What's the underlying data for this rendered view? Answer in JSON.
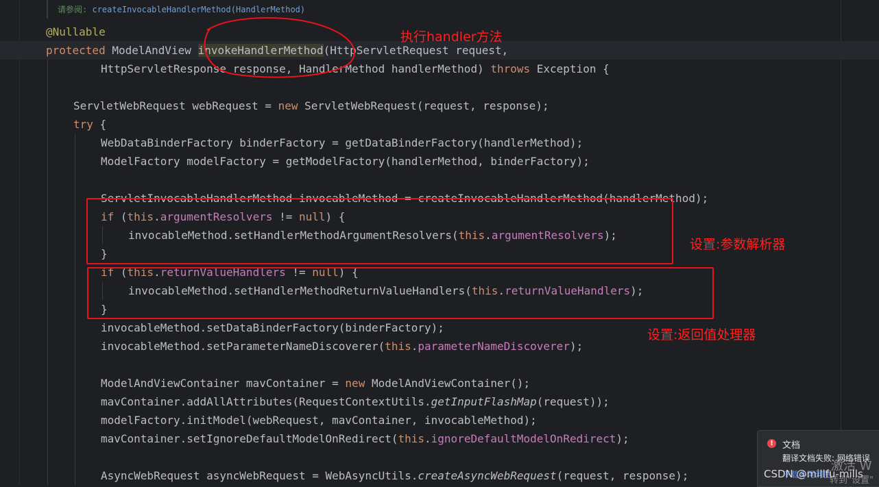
{
  "doc": {
    "label": "请参阅:",
    "link": "createInvocableHandlerMethod(HandlerMethod)"
  },
  "code": {
    "l1": {
      "ann": "@Nullable"
    },
    "l2": {
      "kw": "protected",
      "t1": " ModelAndView ",
      "method": "invokeHandlerMethod",
      "t2": "(HttpServletRequest request,"
    },
    "l3": {
      "t1": "HttpServletResponse response, HandlerMethod handlerMethod) ",
      "kw": "throws",
      "t2": " Exception {"
    },
    "l4": {
      "t1": "ServletWebRequest webRequest = ",
      "kw": "new",
      "t2": " ServletWebRequest(request, response);"
    },
    "l5": {
      "kw": "try",
      "t1": " {"
    },
    "l6": {
      "t1": "WebDataBinderFactory binderFactory = getDataBinderFactory(handlerMethod);"
    },
    "l7": {
      "t1": "ModelFactory modelFactory = getModelFactory(handlerMethod, binderFactory);"
    },
    "l8": {
      "t1": "ServletInvocableHandlerMethod invocableMethod = createInvocableHandlerMethod(handlerMethod);"
    },
    "l9": {
      "kw": "if",
      "t1": " (",
      "kw2": "this",
      "t2": ".",
      "fld": "argumentResolvers",
      "t3": " != ",
      "kw3": "null",
      "t4": ") {"
    },
    "l10": {
      "t1": "invocableMethod.setHandlerMethodArgumentResolvers(",
      "kw": "this",
      "t2": ".",
      "fld": "argumentResolvers",
      "t3": ");"
    },
    "l11": {
      "t1": "}"
    },
    "l12": {
      "kw": "if",
      "t1": " (",
      "kw2": "this",
      "t2": ".",
      "fld": "returnValueHandlers",
      "t3": " != ",
      "kw3": "null",
      "t4": ") {"
    },
    "l13": {
      "t1": "invocableMethod.setHandlerMethodReturnValueHandlers(",
      "kw": "this",
      "t2": ".",
      "fld": "returnValueHandlers",
      "t3": ");"
    },
    "l14": {
      "t1": "}"
    },
    "l15": {
      "t1": "invocableMethod.setDataBinderFactory(binderFactory);"
    },
    "l16": {
      "t1": "invocableMethod.setParameterNameDiscoverer(",
      "kw": "this",
      "t2": ".",
      "fld": "parameterNameDiscoverer",
      "t3": ");"
    },
    "l17": {
      "t1": "ModelAndViewContainer mavContainer = ",
      "kw": "new",
      "t2": " ModelAndViewContainer();"
    },
    "l18": {
      "t1": "mavContainer.addAllAttributes(RequestContextUtils.",
      "it": "getInputFlashMap",
      "t2": "(request));"
    },
    "l19": {
      "t1": "modelFactory.initModel(webRequest, mavContainer, invocableMethod);"
    },
    "l20": {
      "t1": "mavContainer.setIgnoreDefaultModelOnRedirect(",
      "kw": "this",
      "t2": ".",
      "fld": "ignoreDefaultModelOnRedirect",
      "t3": ");"
    },
    "l21": {
      "t1": "AsyncWebRequest asyncWebRequest = WebAsyncUtils.",
      "it": "createAsyncWebRequest",
      "t2": "(request, response);"
    }
  },
  "annotations": {
    "handler": "执行handler方法",
    "resolvers": "设置:参数解析器",
    "returns": "设置:返回值处理器"
  },
  "notification": {
    "title": "文档",
    "message": "翻译文档失败: 网络错误",
    "link": "下载@河河图"
  },
  "watermark": {
    "activate": "激活 W",
    "goto": "转到\"设置\"",
    "csdn": "CSDN @millfu-mills"
  },
  "colors": {
    "background": "#1e1f22",
    "keyword": "#cf8e6d",
    "field": "#c77dbb",
    "annotation": "#b3ae60",
    "markup": "#e8131d"
  }
}
